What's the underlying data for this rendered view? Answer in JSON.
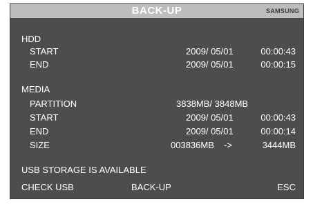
{
  "title": "BACK-UP",
  "brand": "SAMSUNG",
  "hdd": {
    "label": "HDD",
    "start": {
      "label": "START",
      "date": "2009/ 05/01",
      "time": "00:00:43"
    },
    "end": {
      "label": "END",
      "date": "2009/ 05/01",
      "time": "00:00:15"
    }
  },
  "media": {
    "label": "MEDIA",
    "partition": {
      "label": "PARTITION",
      "value": "3838MB/  3848MB"
    },
    "start": {
      "label": "START",
      "date": "2009/ 05/01",
      "time": "00:00:43"
    },
    "end": {
      "label": "END",
      "date": "2009/ 05/01",
      "time": "00:00:14"
    },
    "size": {
      "label": "SIZE",
      "from": "003836MB",
      "arrow": "->",
      "to": "3444MB"
    }
  },
  "status": "USB STORAGE IS AVAILABLE",
  "buttons": {
    "check_usb": "CHECK USB",
    "backup": "BACK-UP",
    "esc": "ESC"
  }
}
